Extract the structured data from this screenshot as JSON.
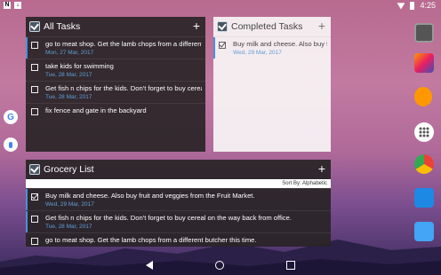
{
  "status_bar": {
    "time": "4:25"
  },
  "all_tasks": {
    "title": "All Tasks",
    "add": "+",
    "tasks": [
      {
        "text": "go to meat shop. Get the lamb chops from a different b",
        "date": "Mon, 27 Mar, 2017",
        "checked": false
      },
      {
        "text": "take kids for swimming",
        "date": "Tue, 28 Mar, 2017",
        "checked": false
      },
      {
        "text": "Get fish n chips for the kids. Don't forget to buy cereal o",
        "date": "Tue, 28 Mar, 2017",
        "checked": false
      },
      {
        "text": "fix fence and gate in the backyard",
        "date": "",
        "checked": false
      }
    ]
  },
  "completed_tasks": {
    "title": "Completed Tasks",
    "add": "+",
    "tasks": [
      {
        "text": "Buy milk and cheese. Also buy fr",
        "date": "Wed, 29 Mar, 2017",
        "checked": true
      }
    ]
  },
  "grocery_list": {
    "title": "Grocery List",
    "add": "+",
    "sort_label": "Sort By: Alphabetic",
    "tasks": [
      {
        "text": "Buy milk and cheese. Also buy fruit and veggies from the Fruit Market.",
        "date": "Wed, 29 Mar, 2017",
        "checked": true
      },
      {
        "text": "Get fish n chips for the kids. Don't forget to buy cereal on the way back from office.",
        "date": "Tue, 28 Mar, 2017",
        "checked": false
      },
      {
        "text": "go to meat shop. Get the lamb chops from a different butcher this time.",
        "date": "",
        "checked": false
      }
    ]
  },
  "google_letter": "G"
}
